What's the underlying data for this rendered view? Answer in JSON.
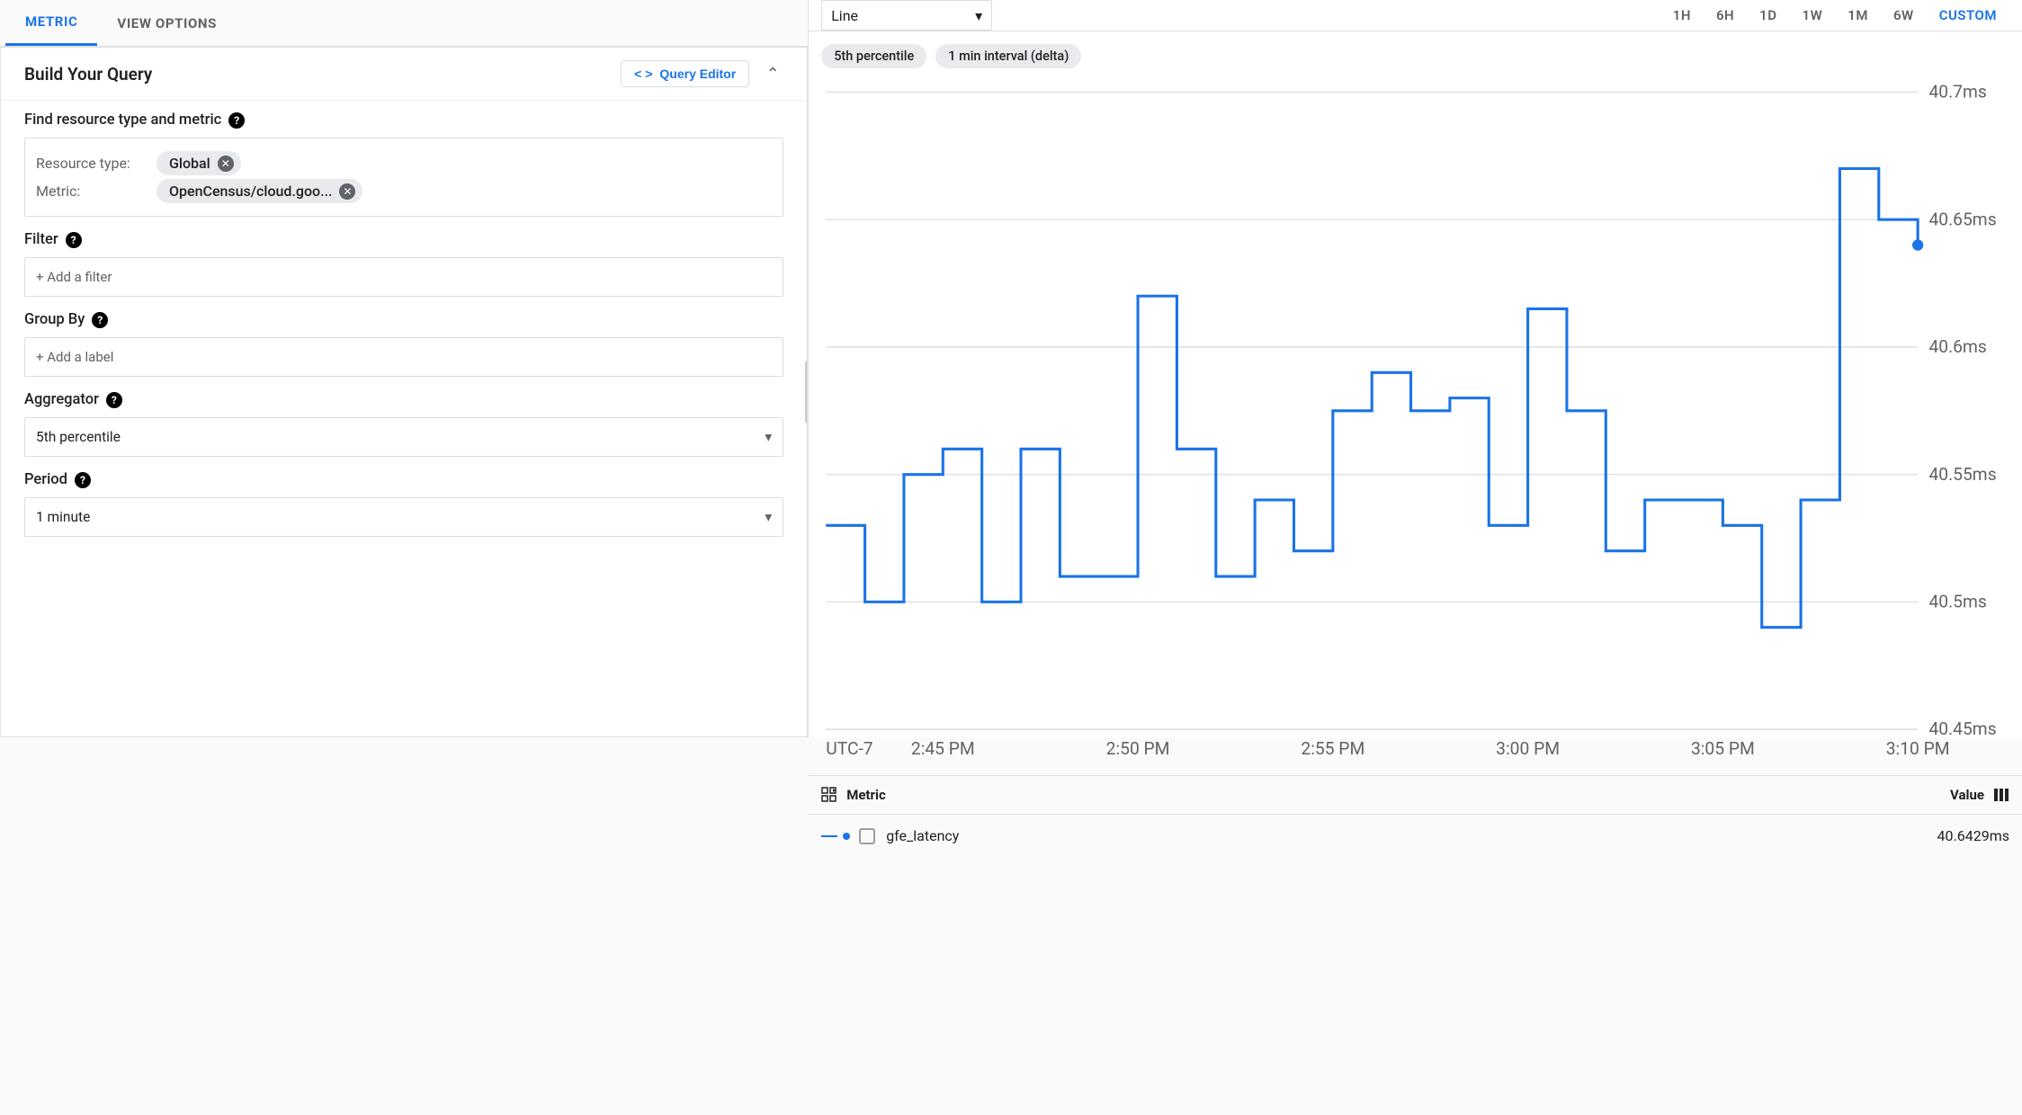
{
  "tabs": {
    "metric": "METRIC",
    "view_options": "VIEW OPTIONS"
  },
  "builder": {
    "title": "Build Your Query",
    "query_editor": "Query Editor",
    "find_label": "Find resource type and metric",
    "resource_label": "Resource type:",
    "resource_value": "Global",
    "metric_label": "Metric:",
    "metric_value": "OpenCensus/cloud.goo...",
    "filter_label": "Filter",
    "filter_placeholder": "+ Add a filter",
    "groupby_label": "Group By",
    "groupby_placeholder": "+ Add a label",
    "aggregator_label": "Aggregator",
    "aggregator_value": "5th percentile",
    "period_label": "Period",
    "period_value": "1 minute"
  },
  "toolbar": {
    "chart_type": "Line",
    "ranges": [
      "1H",
      "6H",
      "1D",
      "1W",
      "1M",
      "6W",
      "CUSTOM"
    ],
    "active_range": "CUSTOM"
  },
  "badges": [
    "5th percentile",
    "1 min interval (delta)"
  ],
  "legend": {
    "metric_header": "Metric",
    "value_header": "Value",
    "series_name": "gfe_latency",
    "series_value": "40.6429ms"
  },
  "chart_data": {
    "type": "line",
    "title": "",
    "xlabel": "UTC-7",
    "ylabel": "",
    "timezone": "UTC-7",
    "x_ticks": [
      "2:45 PM",
      "2:50 PM",
      "2:55 PM",
      "3:00 PM",
      "3:05 PM",
      "3:10 PM"
    ],
    "y_ticks": [
      "40.45ms",
      "40.5ms",
      "40.55ms",
      "40.6ms",
      "40.65ms",
      "40.7ms"
    ],
    "ylim": [
      40.45,
      40.7
    ],
    "series": [
      {
        "name": "gfe_latency",
        "x_minute_offset": [
          0,
          1,
          2,
          3,
          4,
          5,
          6,
          7,
          8,
          9,
          10,
          11,
          12,
          13,
          14,
          15,
          16,
          17,
          18,
          19,
          20,
          21,
          22,
          23,
          24,
          25,
          26,
          27,
          28
        ],
        "values": [
          40.53,
          40.5,
          40.55,
          40.56,
          40.5,
          40.56,
          40.51,
          40.51,
          40.62,
          40.56,
          40.51,
          40.54,
          40.52,
          40.575,
          40.59,
          40.575,
          40.58,
          40.53,
          40.615,
          40.575,
          40.52,
          40.54,
          40.54,
          40.53,
          40.49,
          40.54,
          40.67,
          40.65,
          40.64
        ]
      }
    ]
  }
}
